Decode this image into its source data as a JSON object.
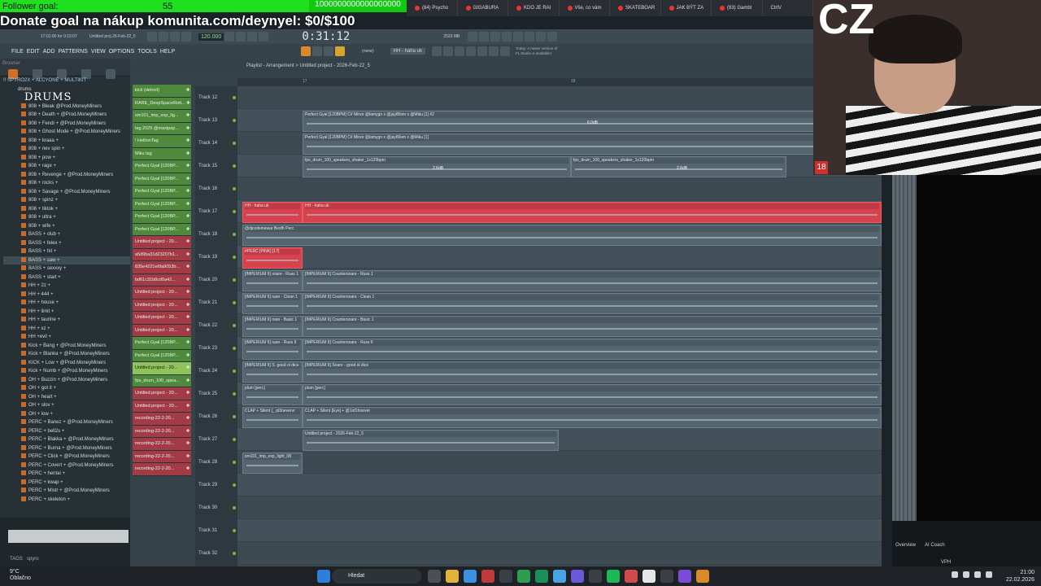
{
  "overlay": {
    "follower_goal_label": "Follower goal:",
    "follower_count": "55",
    "goal_number": "1000000000000000000",
    "donate_text": "Donate goal na nákup komunita.com/deynyel: $0/$100"
  },
  "browser_tabs": [
    "(84) Psycho",
    "GIGABURA",
    "KDO JE RAI",
    "Vše, co vám",
    "SKATEBOAR",
    "JAK BÝT ZA",
    "(83) Gambl",
    "CtrlV"
  ],
  "fl": {
    "menu": [
      "FILE",
      "EDIT",
      "ADD",
      "PATTERNS",
      "VIEW",
      "OPTIONS",
      "TOOLS",
      "HELP"
    ],
    "time": "0:31:12",
    "bpm": "120.000",
    "hint_time": "17:01:00 for 0:15:07",
    "project_short": "Untitled proj 26-Feb-22_5",
    "news_line1": "Today: A newer version of",
    "news_line2": "FL Studio is available!",
    "memory": "2523 MB",
    "pattern_label": "HH - haha uk",
    "none_label": "(none)",
    "playlist_title": "Playlist - Arrangement > Untitled project - 2026-Feb-22_5"
  },
  "sidebar": {
    "header": "Browser",
    "root": "!! SPYRO2X + ALCYONE + MULTIKIT",
    "folder": "drums",
    "title_art": "DRUMS",
    "items": [
      "808 + Bleak @Prod.MoneyMiners",
      "808 + Death + @Prod.MoneyMiners",
      "808 + Fendi + @Prod.MoneyMiners",
      "808 + Ghost Mode + @Prod.MoneyMiners",
      "808 + kraaa +",
      "808 + nev spin +",
      "808 + pow +",
      "808 + rage +",
      "808 + Revenge + @Prod.MoneyMiners",
      "808 + rocks +",
      "808 + Savage + @Prod.MoneyMiners",
      "808 + spinz +",
      "808 + tiktok +",
      "808 + ultra +",
      "808 + wife +",
      "BASS + club +",
      "BASS + felex +",
      "BASS + hit +",
      "BASS + saw +",
      "BASS + sexxxy +",
      "BASS + start +",
      "HH + 2z +",
      "HH + 444 +",
      "HH + house +",
      "HH + limit +",
      "HH + taurine +",
      "HH + xz +",
      "HH +evil +",
      "Kick + Bang + @Prod.MoneyMiners",
      "Kick + Blanka + @Prod.MoneyMiners",
      "KICK + Low + @Prod.MoneyMiners",
      "Kick + Numb + @Prod.MoneyMiners",
      "OH + Buzzin + @Prod.MoneyMiners",
      "OH + got it +",
      "OH + heart +",
      "OH + slov +",
      "OH + low +",
      "PERC + Banez + @Prod.MoneyMiners",
      "PERC + bell2s +",
      "PERC + Blakka + @Prod.MoneyMiners",
      "PERC + Burna + @Prod.MoneyMiners",
      "PERC + Click + @Prod.MoneyMiners",
      "PERC + Covert + @Prod.MoneyMiners",
      "PERC + hentai +",
      "PERC + kwap +",
      "PERC + Mistr + @Prod.MoneyMiners",
      "PERC + skeleton +"
    ],
    "tags_label": "TAGS",
    "tags_value": "spyro"
  },
  "channels": [
    {
      "label": "kick (detroit)",
      "color": "g"
    },
    {
      "label": "RARE_DeepSpaceRott...",
      "color": "g"
    },
    {
      "label": "sm101_imp_exp_lig...",
      "color": "g"
    },
    {
      "label": "tag 2025 @maxipep...",
      "color": "g"
    },
    {
      "label": "! HellionTag",
      "color": "g"
    },
    {
      "label": "Miku tag",
      "color": "g"
    },
    {
      "label": "Perfect Gyal [120BP...",
      "color": "g"
    },
    {
      "label": "Perfect Gyal [120BP...",
      "color": "g"
    },
    {
      "label": "Perfect Gyal [120BP...",
      "color": "g"
    },
    {
      "label": "Perfect Gyal [120BP...",
      "color": "g"
    },
    {
      "label": "Perfect Gyal [120BP...",
      "color": "g"
    },
    {
      "label": "Perfect Gyal [120BP...",
      "color": "g"
    },
    {
      "label": "Untitled project - 20...",
      "color": "r"
    },
    {
      "label": "a5d9ba31d23207b1...",
      "color": "r"
    },
    {
      "label": "835e4221e6fa9053b...",
      "color": "r"
    },
    {
      "label": "bd61c31b8cd0a42...",
      "color": "r"
    },
    {
      "label": "Untitled project - 20...",
      "color": "r"
    },
    {
      "label": "Untitled project - 20...",
      "color": "r"
    },
    {
      "label": "Untitled project - 20...",
      "color": "r"
    },
    {
      "label": "Untitled project - 20...",
      "color": "r"
    },
    {
      "label": "Perfect Gyal [120BP...",
      "color": "g"
    },
    {
      "label": "Perfect Gyal [120BP...",
      "color": "g"
    },
    {
      "label": "Untitled project - 20...",
      "color": "sel"
    },
    {
      "label": "fps_drum_100_spea...",
      "color": "g"
    },
    {
      "label": "Untitled project - 20...",
      "color": "r"
    },
    {
      "label": "Untitled project - 20...",
      "color": "r"
    },
    {
      "label": "recording-22-2-20...",
      "color": "r"
    },
    {
      "label": "recording-22-2-20...",
      "color": "r"
    },
    {
      "label": "recording-22-2-20...",
      "color": "r"
    },
    {
      "label": "recording-22-2-20...",
      "color": "r"
    },
    {
      "label": "recording-22-2-20...",
      "color": "r"
    }
  ],
  "ruler_marks": [
    "17",
    "18"
  ],
  "tracks": [
    "Track 12",
    "Track 13",
    "Track 14",
    "Track 15",
    "Track 16",
    "Track 17",
    "Track 18",
    "Track 19",
    "Track 20",
    "Track 21",
    "Track 22",
    "Track 23",
    "Track 24",
    "Track 25",
    "Track 26",
    "Track 27",
    "Track 28",
    "Track 29",
    "Track 30",
    "Track 31",
    "Track 32"
  ],
  "clips": {
    "t13": "Perfect Gyal [120BPM] C# Minor @lamygn x @jay80sm x @Miku [1] #2",
    "t14": "Perfect Gyal [120BPM] C# Minor @lamygn x @jay80sm x @Miku [1]",
    "t15a": "fps_drum_100_speakers_shaker_1x120bpm",
    "t15b": "fps_drum_100_speakers_shaker_1x120bpm",
    "t17a": "HH - haha uk",
    "t17b": "HH - haha uk",
    "t18": "@djcodeinewar Besfh Perc",
    "t19": "#PERC [PINK] [17]",
    "t20a": "[IMPERIUM II] snare - Russ 1",
    "t20b": "[IMPERIUM II] Countersnare - Russ 1",
    "t21a": "[IMPERIUM II] nare - Clean 1",
    "t21b": "[IMPERIUM II] Countersnare - Clean 1",
    "t22a": "[IMPERIUM II] nare - Basic 1",
    "t22b": "[IMPERIUM II] Countersnare - Basic 1",
    "t23a": "[IMPERIUM II] nare - Russ II",
    "t23b": "[IMPERIUM II] Countersnare - Russ II",
    "t24a": "[IMPERIUM II] S. good ol dice",
    "t24b": "[IMPERIUM II] Snare - good ol dice",
    "t25a": "plum [perc]",
    "t25b": "plum [perc]",
    "t26a": "CLAP + Silent [_ pt3nevervr",
    "t26b": "CLAP + Silent [Eye] + @1of1forever",
    "t27": "Untitled project - 2026-Feb-22_5",
    "t28": "sm101_imp_exp_light_08",
    "gain1": "6.0dB",
    "gain2": "2.6dB"
  },
  "webcam": {
    "logo": "CZ",
    "age_badge": "18"
  },
  "right_panel": {
    "overview": "Overview",
    "ai_coach": "AI Coach",
    "vph": "VPH"
  },
  "taskbar": {
    "weather_temp": "9°C",
    "weather_desc": "Oblačno",
    "search": "Hledat",
    "time": "21:00",
    "date": "22.02.2026"
  }
}
